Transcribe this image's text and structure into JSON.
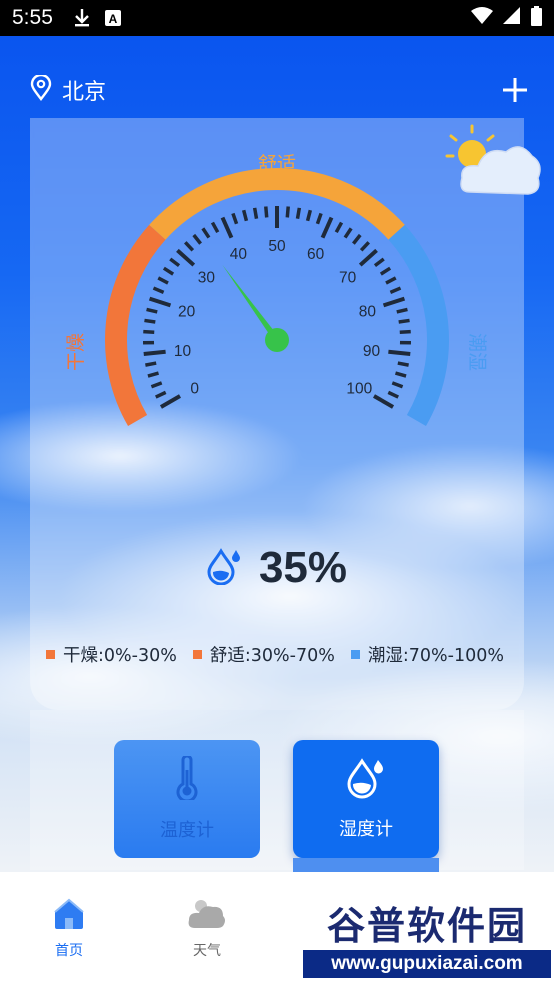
{
  "status_bar": {
    "time": "5:55",
    "icons": [
      "download-icon",
      "keyboard-a-icon",
      "wifi-icon",
      "signal-icon",
      "battery-icon"
    ]
  },
  "header": {
    "city": "北京",
    "location_icon": "location-pin-icon",
    "add_icon": "plus-icon"
  },
  "gauge": {
    "zone_labels": {
      "dry": "干燥",
      "comfort": "舒适",
      "humid": "潮湿"
    },
    "tick_labels": [
      "0",
      "10",
      "20",
      "30",
      "40",
      "50",
      "60",
      "70",
      "80",
      "90",
      "100"
    ],
    "value": 35,
    "colors": {
      "dry": "#f2763a",
      "comfort": "#f5a43a",
      "humid": "#4a9cf2",
      "needle": "#37c34a"
    }
  },
  "reading": {
    "value_text": "35%",
    "icon": "humidity-drop-icon"
  },
  "legend": [
    {
      "text": "干燥:0%-30%",
      "color": "#f2763a"
    },
    {
      "text": "舒适:30%-70%",
      "color": "#f2763a"
    },
    {
      "text": "潮湿:70%-100%",
      "color": "#4a9cf2"
    }
  ],
  "tiles": {
    "thermometer": {
      "label": "温度计",
      "icon": "thermometer-icon"
    },
    "hygrometer": {
      "label": "湿度计",
      "icon": "humidity-drop-icon"
    }
  },
  "bottom_nav": [
    {
      "label": "首页",
      "icon": "home-icon",
      "active": true
    },
    {
      "label": "天气",
      "icon": "cloud-icon",
      "active": false
    }
  ],
  "watermark": {
    "title": "谷普软件园",
    "url": "www.gupuxiazai.com"
  }
}
